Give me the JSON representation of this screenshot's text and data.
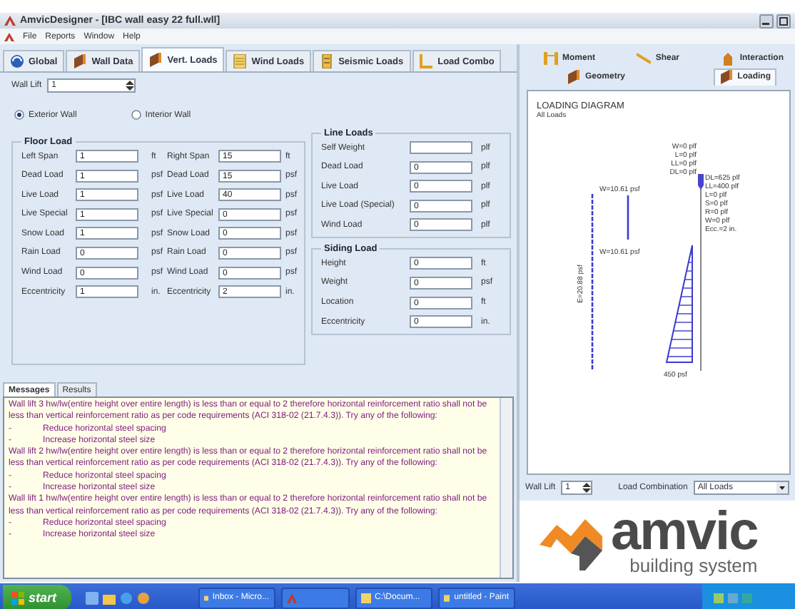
{
  "window": {
    "title": "AmvicDesigner - [IBC wall easy 22 full.wll]"
  },
  "menu": [
    "File",
    "Reports",
    "Window",
    "Help"
  ],
  "tabs": [
    {
      "label": "Global",
      "selected": false
    },
    {
      "label": "Wall Data",
      "selected": false
    },
    {
      "label": "Vert. Loads",
      "selected": true
    },
    {
      "label": "Wind Loads",
      "selected": false
    },
    {
      "label": "Seismic Loads",
      "selected": false
    },
    {
      "label": "Load Combo",
      "selected": false
    }
  ],
  "wall_lift": {
    "label": "Wall Lift",
    "value": "1"
  },
  "wall_type": [
    {
      "label": "Exterior Wall",
      "selected": true
    },
    {
      "label": "Interior Wall",
      "selected": false
    }
  ],
  "floor_load": {
    "title": "Floor Load",
    "left": [
      {
        "label": "Left Span",
        "value": "1",
        "unit": "ft"
      },
      {
        "label": "Dead Load",
        "value": "1",
        "unit": "psf"
      },
      {
        "label": "Live Load",
        "value": "1",
        "unit": "psf"
      },
      {
        "label": "Live Special",
        "value": "1",
        "unit": "psf"
      },
      {
        "label": "Snow Load",
        "value": "1",
        "unit": "psf"
      },
      {
        "label": "Rain Load",
        "value": "0",
        "unit": "psf"
      },
      {
        "label": "Wind Load",
        "value": "0",
        "unit": "psf"
      },
      {
        "label": "Eccentricity",
        "value": "1",
        "unit": "in."
      }
    ],
    "right": [
      {
        "label": "Right Span",
        "value": "15",
        "unit": "ft"
      },
      {
        "label": "Dead Load",
        "value": "15",
        "unit": "psf"
      },
      {
        "label": "Live Load",
        "value": "40",
        "unit": "psf"
      },
      {
        "label": "Live Special",
        "value": "0",
        "unit": "psf"
      },
      {
        "label": "Snow Load",
        "value": "0",
        "unit": "psf"
      },
      {
        "label": "Rain Load",
        "value": "0",
        "unit": "psf"
      },
      {
        "label": "Wind Load",
        "value": "0",
        "unit": "psf"
      },
      {
        "label": "Eccentricity",
        "value": "2",
        "unit": "in."
      }
    ]
  },
  "line_loads": {
    "title": "Line Loads",
    "rows": [
      {
        "label": "Self Weight",
        "unit": "plf"
      },
      {
        "label": "Dead Load",
        "value": "0",
        "unit": "plf"
      },
      {
        "label": "Live Load",
        "value": "0",
        "unit": "plf"
      },
      {
        "label": "Live Load (Special)",
        "value": "0",
        "unit": "plf"
      },
      {
        "label": "Wind Load",
        "value": "0",
        "unit": "plf"
      }
    ]
  },
  "siding_load": {
    "title": "Siding Load",
    "rows": [
      {
        "label": "Height",
        "value": "0",
        "unit": "ft"
      },
      {
        "label": "Weight",
        "value": "0",
        "unit": "psf"
      },
      {
        "label": "Location",
        "value": "0",
        "unit": "ft"
      },
      {
        "label": "Eccentricity",
        "value": "0",
        "unit": "in."
      }
    ]
  },
  "message_tabs": [
    {
      "label": "Messages",
      "selected": true
    },
    {
      "label": "Results",
      "selected": false
    }
  ],
  "messages": [
    {
      "kind": "paragraph",
      "text": "Wall lift 3 hw/lw(entire height over entire length) is less than or equal to 2 therefore horizontal reinforcement ratio shall not be less than vertical reinforcement ratio as per code requirements (ACI 318-02 (21.7.4.3)). Try any of the following:"
    },
    {
      "kind": "step",
      "marker": "-",
      "text": "Reduce horizontal steel spacing"
    },
    {
      "kind": "step",
      "marker": "-",
      "text": "Increase horizontal steel size"
    },
    {
      "kind": "paragraph",
      "text": "Wall lift 2 hw/lw(entire height over entire length) is less than or equal to 2 therefore horizontal reinforcement ratio shall not be less than vertical reinforcement ratio as per code requirements (ACI 318-02 (21.7.4.3)). Try any of the following:"
    },
    {
      "kind": "step",
      "marker": "-",
      "text": "Reduce horizontal steel spacing"
    },
    {
      "kind": "step",
      "marker": "-",
      "text": "Increase horizontal steel size"
    },
    {
      "kind": "paragraph",
      "text": "Wall lift 1 hw/lw(entire height over entire length) is less than or equal to 2 therefore horizontal reinforcement ratio shall not be less than vertical reinforcement ratio as per code requirements (ACI 318-02 (21.7.4.3)). Try any of the following:"
    },
    {
      "kind": "step",
      "marker": "-",
      "text": "Reduce horizontal steel spacing"
    },
    {
      "kind": "step",
      "marker": "-",
      "text": "Increase horizontal steel size"
    }
  ],
  "result_tabs": [
    [
      {
        "label": "Moment",
        "selected": false
      },
      {
        "label": "Shear",
        "selected": false
      },
      {
        "label": "Interaction",
        "selected": false
      }
    ],
    [
      {
        "label": "Geometry",
        "selected": false
      },
      {
        "label": "Loading",
        "selected": true
      }
    ]
  ],
  "diagram": {
    "title": "LOADING DIAGRAM",
    "subtitle": "All Loads",
    "top_labels": [
      "W=0 plf",
      "L=0 plf",
      "LL=0 plf",
      "DL=0 plf"
    ],
    "bottom_labels": [
      "DL=625 plf",
      "LL=400 plf",
      "L=0 plf",
      "S=0 plf",
      "R=0 plf",
      "W=0 plf",
      "Ecc.=2 in."
    ],
    "wind_labels": [
      "W=10.61 psf",
      "W=10.61 psf"
    ],
    "eccentric_label": "E=20.88 psf",
    "base_label": "450 psf"
  },
  "footer": {
    "wall_lift_label": "Wall Lift",
    "wall_lift_value": "1",
    "combination_label": "Load Combination",
    "combination_value": "All Loads"
  },
  "logo": {
    "name": "amvic",
    "tagline": "building system"
  },
  "taskbar": {
    "start": "start",
    "tasks": [
      {
        "label": "Inbox - Micro..."
      },
      {
        "kind": "icon-only"
      },
      {
        "label": "C:\\Docum..."
      },
      {
        "label": "untitled - Paint"
      }
    ]
  }
}
